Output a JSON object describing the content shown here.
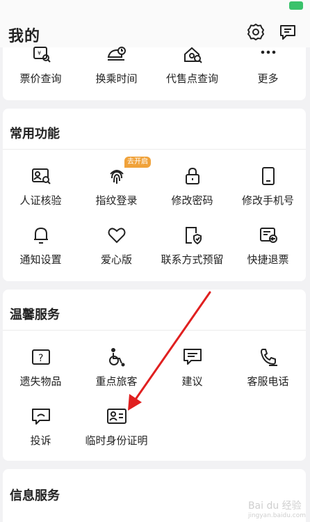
{
  "header": {
    "title": "我的"
  },
  "top_row": {
    "items": [
      {
        "label": "票价查询",
        "icon": "fare-search-icon"
      },
      {
        "label": "换乘时间",
        "icon": "transfer-time-icon"
      },
      {
        "label": "代售点查询",
        "icon": "agency-search-icon"
      },
      {
        "label": "更多",
        "icon": "more-icon"
      }
    ]
  },
  "common": {
    "title": "常用功能",
    "badge": "去开启",
    "items": [
      {
        "label": "人证核验",
        "icon": "id-verify-icon"
      },
      {
        "label": "指纹登录",
        "icon": "fingerprint-icon"
      },
      {
        "label": "修改密码",
        "icon": "lock-icon"
      },
      {
        "label": "修改手机号",
        "icon": "phone-icon"
      },
      {
        "label": "通知设置",
        "icon": "bell-icon"
      },
      {
        "label": "爱心版",
        "icon": "heart-icon"
      },
      {
        "label": "联系方式预留",
        "icon": "contact-shield-icon"
      },
      {
        "label": "快捷退票",
        "icon": "refund-ticket-icon"
      }
    ]
  },
  "warm": {
    "title": "温馨服务",
    "items": [
      {
        "label": "遗失物品",
        "icon": "lost-item-icon"
      },
      {
        "label": "重点旅客",
        "icon": "wheelchair-icon"
      },
      {
        "label": "建议",
        "icon": "suggestion-icon"
      },
      {
        "label": "客服电话",
        "icon": "phone-call-icon"
      },
      {
        "label": "投诉",
        "icon": "complaint-icon"
      },
      {
        "label": "临时身份证明",
        "icon": "temp-id-icon"
      }
    ]
  },
  "info": {
    "title": "信息服务"
  },
  "watermark": {
    "text": "Bai du 经验",
    "sub": "jingyan.baidu.com"
  },
  "colors": {
    "badge": "#f0a23a",
    "arrow": "#e02020",
    "battery": "#3ac26b"
  }
}
